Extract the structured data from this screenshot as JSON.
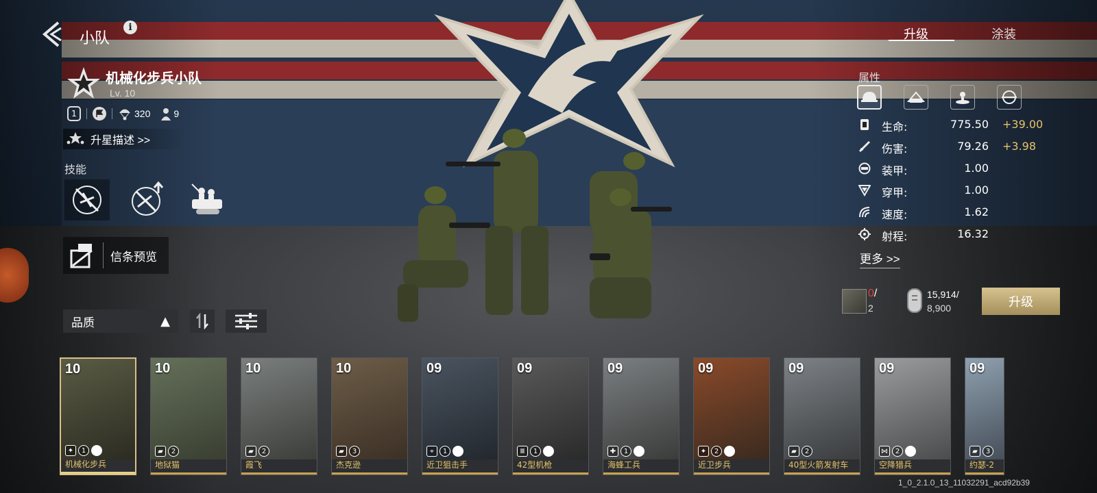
{
  "header": {
    "back_label": "",
    "title": "小队",
    "info_label": "i"
  },
  "top_tabs": [
    {
      "label": "升级",
      "active": true
    },
    {
      "label": "涂装",
      "active": false
    }
  ],
  "squad": {
    "name": "机械化步兵小队",
    "level_label": "Lv. 10",
    "tier": "1",
    "cost": "320",
    "members": "9",
    "star_desc_label": "升星描述 >>"
  },
  "skills": {
    "heading": "技能",
    "items": [
      {
        "icon": "no-infantry-icon"
      },
      {
        "icon": "upgrade-infantry-icon"
      },
      {
        "icon": "squad-vehicle-icon"
      }
    ]
  },
  "faith_preview_label": "信条预览",
  "filters": {
    "sort_label": "品质",
    "sort_arrow": "▲"
  },
  "attributes": {
    "heading": "属性",
    "category_icons": [
      "helmet-icon",
      "tank-icon",
      "artillery-icon",
      "aircraft-icon"
    ],
    "stats": [
      {
        "label": "生命:",
        "value": "775.50",
        "bonus": "+39.00",
        "icon": "health-icon"
      },
      {
        "label": "伤害:",
        "value": "79.26",
        "bonus": "+3.98",
        "icon": "damage-icon"
      },
      {
        "label": "装甲:",
        "value": "1.00",
        "bonus": "",
        "icon": "armor-icon"
      },
      {
        "label": "穿甲:",
        "value": "1.00",
        "bonus": "",
        "icon": "penetration-icon"
      },
      {
        "label": "速度:",
        "value": "1.62",
        "bonus": "",
        "icon": "speed-icon"
      },
      {
        "label": "射程:",
        "value": "16.32",
        "bonus": "",
        "icon": "range-icon"
      }
    ],
    "more_label": "更多 >>"
  },
  "upgrade": {
    "cards_owned": "0",
    "cards_separator": "/",
    "cards_required": "2",
    "resource_owned": "15,914/",
    "resource_required": "8,900",
    "button_label": "升级"
  },
  "cards": [
    {
      "level": "10",
      "name": "机械化步兵",
      "type_icon": "infantry-icon",
      "tier": "1",
      "flag": true,
      "selected": true
    },
    {
      "level": "10",
      "name": "地狱猫",
      "type_icon": "tank-icon",
      "tier": "2",
      "flag": false,
      "selected": false
    },
    {
      "level": "10",
      "name": "霞飞",
      "type_icon": "tank-icon",
      "tier": "2",
      "flag": false,
      "selected": false
    },
    {
      "level": "10",
      "name": "杰克逊",
      "type_icon": "tank-icon",
      "tier": "3",
      "flag": false,
      "selected": false
    },
    {
      "level": "09",
      "name": "近卫狙击手",
      "type_icon": "sniper-icon",
      "tier": "1",
      "flag": true,
      "selected": false
    },
    {
      "level": "09",
      "name": "42型机枪",
      "type_icon": "machine-gun-icon",
      "tier": "1",
      "flag": true,
      "selected": false
    },
    {
      "level": "09",
      "name": "海蜂工兵",
      "type_icon": "engineer-icon",
      "tier": "1",
      "flag": true,
      "selected": false
    },
    {
      "level": "09",
      "name": "近卫步兵",
      "type_icon": "infantry-icon",
      "tier": "2",
      "flag": true,
      "selected": false
    },
    {
      "level": "09",
      "name": "40型火箭发射车",
      "type_icon": "tank-icon",
      "tier": "2",
      "flag": false,
      "selected": false
    },
    {
      "level": "09",
      "name": "空降猎兵",
      "type_icon": "paratrooper-icon",
      "tier": "2",
      "flag": true,
      "selected": false
    },
    {
      "level": "09",
      "name": "约瑟-2",
      "type_icon": "tank-icon",
      "tier": "3",
      "flag": false,
      "selected": false
    }
  ],
  "build_version": "1_0_2.1.0_13_11032291_acd92b39",
  "colors": {
    "accent_gold": "#e6c36a",
    "button_gold": "#c9b27a",
    "flag_red": "#8e2a2c",
    "flag_blue": "#1f3550"
  }
}
